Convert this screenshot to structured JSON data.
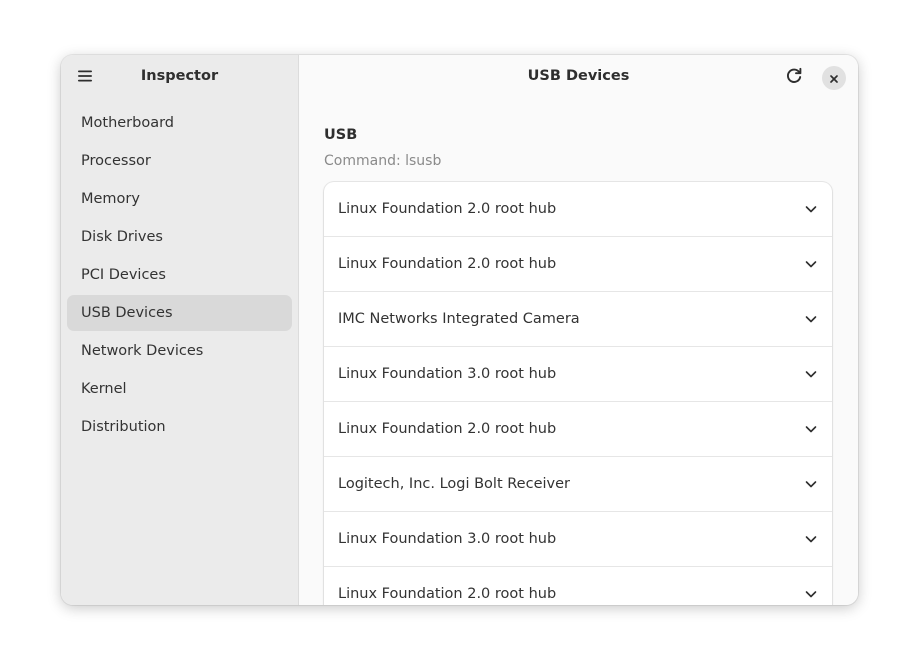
{
  "sidebar": {
    "title": "Inspector",
    "menu_icon": "hamburger-menu-icon",
    "items": [
      {
        "label": "Motherboard",
        "active": false
      },
      {
        "label": "Processor",
        "active": false
      },
      {
        "label": "Memory",
        "active": false
      },
      {
        "label": "Disk Drives",
        "active": false
      },
      {
        "label": "PCI Devices",
        "active": false
      },
      {
        "label": "USB Devices",
        "active": true
      },
      {
        "label": "Network Devices",
        "active": false
      },
      {
        "label": "Kernel",
        "active": false
      },
      {
        "label": "Distribution",
        "active": false
      }
    ]
  },
  "header": {
    "title": "USB Devices",
    "refresh_icon": "refresh-icon",
    "close_icon": "close-icon"
  },
  "section": {
    "title": "USB",
    "subtitle": "Command: lsusb"
  },
  "devices": [
    {
      "label": "Linux Foundation 2.0 root hub"
    },
    {
      "label": "Linux Foundation 2.0 root hub"
    },
    {
      "label": "IMC Networks Integrated Camera"
    },
    {
      "label": "Linux Foundation 3.0 root hub"
    },
    {
      "label": "Linux Foundation 2.0 root hub"
    },
    {
      "label": "Logitech, Inc. Logi Bolt Receiver"
    },
    {
      "label": "Linux Foundation 3.0 root hub"
    },
    {
      "label": "Linux Foundation 2.0 root hub"
    }
  ],
  "colors": {
    "sidebar_bg": "#ebebeb",
    "active_item_bg": "#d9d9d9",
    "content_bg": "#fafafa",
    "row_bg": "#ffffff"
  }
}
